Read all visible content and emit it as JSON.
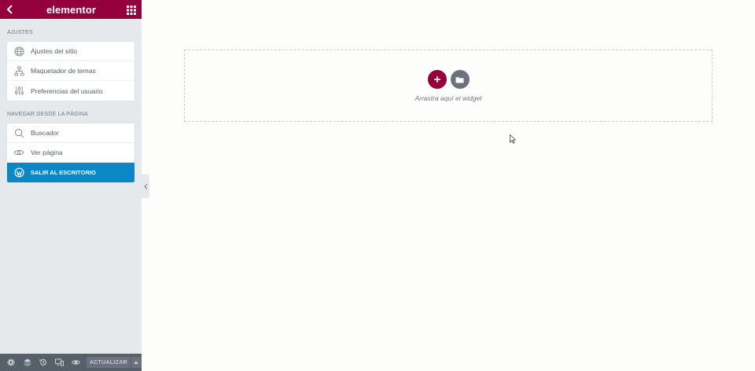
{
  "header": {
    "title": "elementor",
    "back_icon": "chevron-left-icon",
    "grid_icon": "grid-icon",
    "color": "#93003c"
  },
  "settings": {
    "title": "AJUSTES",
    "items": [
      {
        "label": "Ajustes del sitio",
        "icon": "globe-icon"
      },
      {
        "label": "Maquetador de temas",
        "icon": "sitemap-icon"
      },
      {
        "label": "Preferencias del usuario",
        "icon": "sliders-icon"
      }
    ]
  },
  "navigate": {
    "title": "NAVEGAR DESDE LA PÁGINA",
    "items": [
      {
        "label": "Buscador",
        "icon": "search-icon"
      },
      {
        "label": "Ver página",
        "icon": "eye-icon"
      },
      {
        "label": "SALIR AL ESCRITORIO",
        "icon": "wordpress-icon",
        "color": "#0c87c5"
      }
    ]
  },
  "footer": {
    "icons": [
      "gear-icon",
      "layers-icon",
      "history-icon",
      "responsive-icon",
      "eye-icon"
    ],
    "update_label": "ACTUALIZAR",
    "caret_icon": "caret-up-icon"
  },
  "canvas": {
    "hint": "Arrastra aquí el widget",
    "add_icon": "plus-icon",
    "template_icon": "folder-icon"
  }
}
